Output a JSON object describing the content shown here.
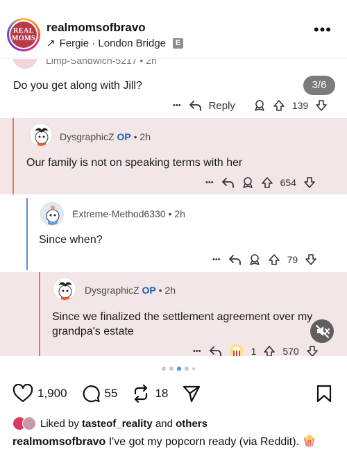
{
  "header": {
    "logo_text": "REAL MOMS",
    "account_name": "realmomsofbravo",
    "location_arrow": "↗",
    "location": "Fergie · London Bridge",
    "badge": "E",
    "more": "•••"
  },
  "post": {
    "counter": "3/6",
    "comments": [
      {
        "user": "Limp-Sandwich-5217",
        "time": "2h",
        "text": "Do you get along with Jill?",
        "reply_label": "Reply",
        "votes": "139"
      },
      {
        "user": "DysgraphicZ",
        "op": "OP",
        "time": "2h",
        "text": "Our family is not on speaking terms with her",
        "votes": "654"
      },
      {
        "user": "Extreme-Method6330",
        "time": "2h",
        "text": "Since when?",
        "votes": "79"
      },
      {
        "user": "DysgraphicZ",
        "op": "OP",
        "time": "2h",
        "text": "Since we finalized the settlement agreement over my grandpa's estate",
        "award_count": "1",
        "votes": "570"
      }
    ],
    "meta_sep": "•",
    "more": "•••"
  },
  "actions": {
    "likes": "1,900",
    "comments": "55",
    "reposts": "18"
  },
  "liked_by": {
    "prefix": "Liked by",
    "user": "tasteof_reality",
    "middle": "and",
    "others": "others"
  },
  "caption": {
    "user": "realmomsofbravo",
    "text": "I've got my popcorn ready (via Reddit).",
    "emoji": "🍿"
  },
  "colors": {
    "thread_bg": "#f2e6e6",
    "indent_line": "#e07a5f",
    "op_blue": "#1a5fb4",
    "active_dot": "#3897f0"
  }
}
